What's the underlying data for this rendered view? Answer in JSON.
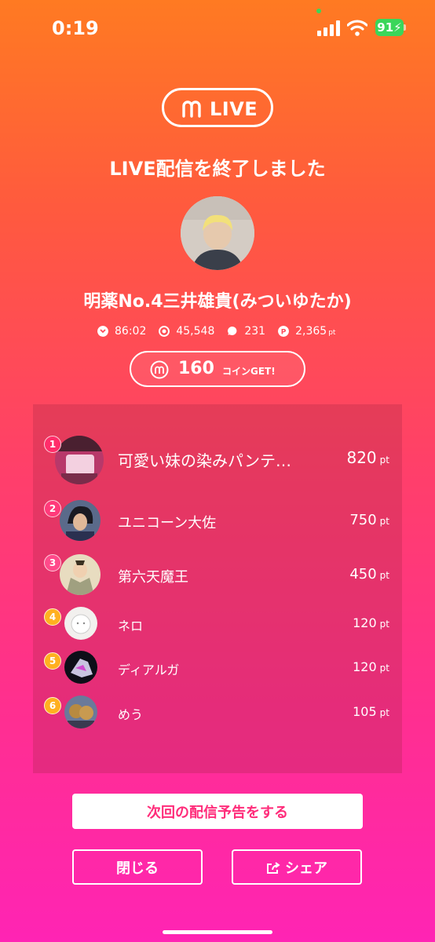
{
  "status_bar": {
    "time": "0:19",
    "battery": "91"
  },
  "header": {
    "logo_text": "LIVE",
    "title": "LIVE配信を終了しました"
  },
  "streamer": {
    "name": "明薬No.4三井雄貴(みついゆたか)"
  },
  "stats": {
    "duration": "86:02",
    "viewers": "45,548",
    "comments": "231",
    "points": "2,365",
    "points_unit": "pt"
  },
  "coins": {
    "value": "160",
    "label": "コインGET!"
  },
  "ranking": [
    {
      "rank": "1",
      "name": "可愛い妹の染みパンテ…",
      "points": "820",
      "unit": "pt"
    },
    {
      "rank": "2",
      "name": "ユニコーン大佐",
      "points": "750",
      "unit": "pt"
    },
    {
      "rank": "3",
      "name": "第六天魔王",
      "points": "450",
      "unit": "pt"
    },
    {
      "rank": "4",
      "name": "ネロ",
      "points": "120",
      "unit": "pt"
    },
    {
      "rank": "5",
      "name": "ディアルガ",
      "points": "120",
      "unit": "pt"
    },
    {
      "rank": "6",
      "name": "めう",
      "points": "105",
      "unit": "pt"
    }
  ],
  "buttons": {
    "announce": "次回の配信予告をする",
    "close": "閉じる",
    "share": "シェア"
  },
  "colors": {
    "accent_pink": "#ff2c7a",
    "battery_green": "#3ad65a"
  }
}
